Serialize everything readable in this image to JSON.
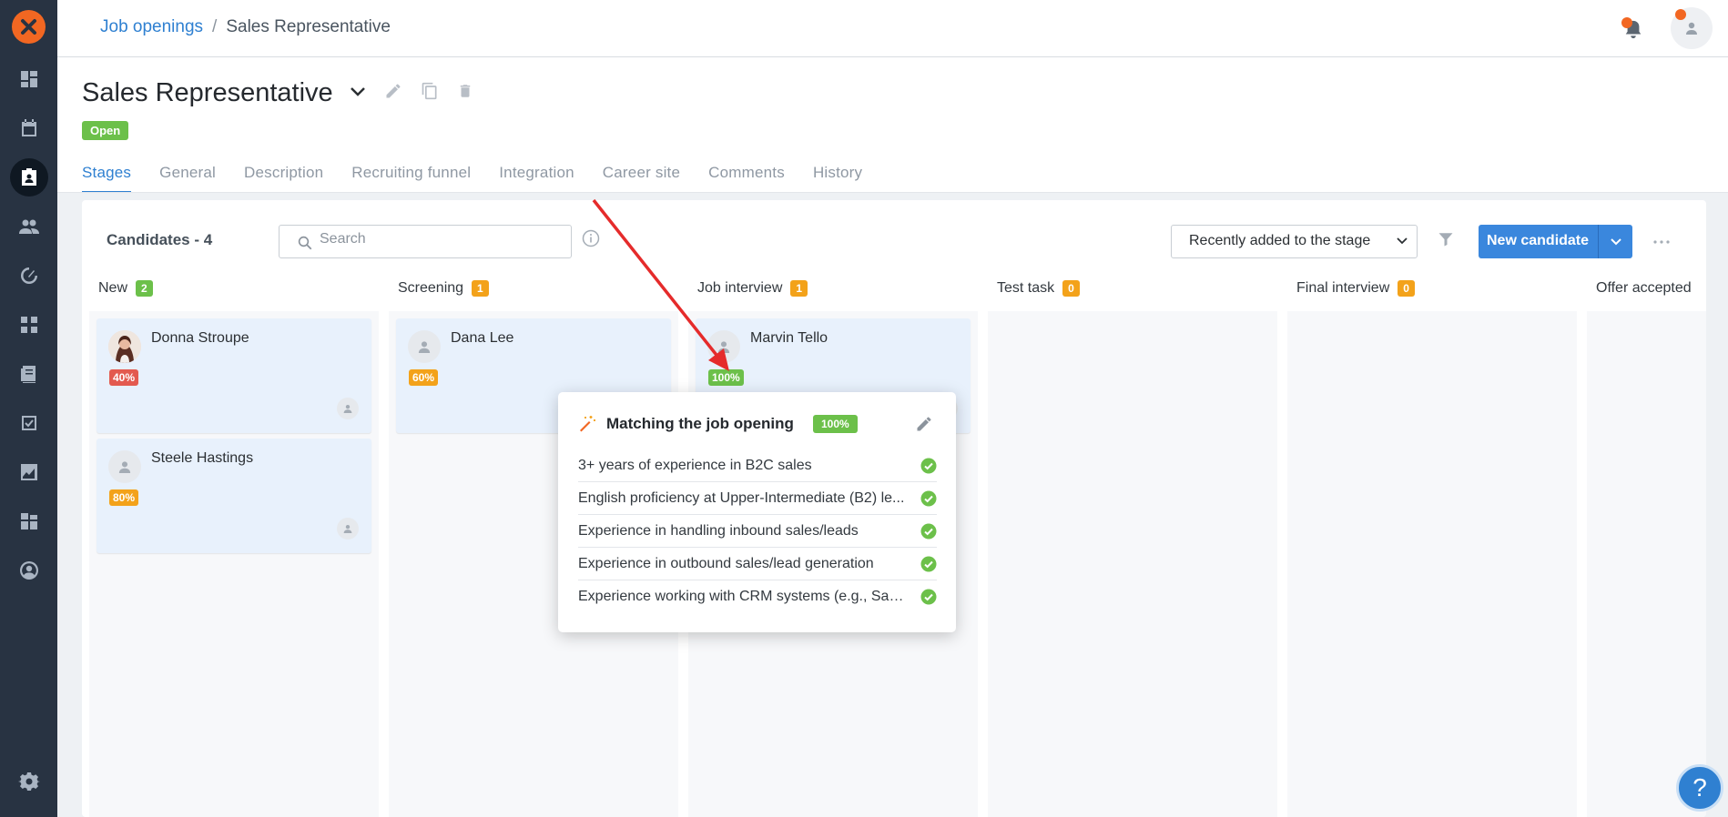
{
  "breadcrumb": {
    "parent": "Job openings",
    "separator": "/",
    "current": "Sales Representative"
  },
  "header": {
    "title": "Sales Representative",
    "status": "Open"
  },
  "tabs": [
    {
      "label": "Stages",
      "active": true
    },
    {
      "label": "General"
    },
    {
      "label": "Description"
    },
    {
      "label": "Recruiting funnel"
    },
    {
      "label": "Integration"
    },
    {
      "label": "Career site"
    },
    {
      "label": "Comments"
    },
    {
      "label": "History"
    }
  ],
  "toolbar": {
    "candidates_label": "Candidates - 4",
    "search_placeholder": "Search",
    "sort_value": "Recently added to the stage",
    "new_candidate_label": "New candidate"
  },
  "columns": [
    {
      "name": "New",
      "count": "2",
      "badge_color": "#6cc04a"
    },
    {
      "name": "Screening",
      "count": "1",
      "badge_color": "#f3a21a"
    },
    {
      "name": "Job interview",
      "count": "1",
      "badge_color": "#f3a21a"
    },
    {
      "name": "Test task",
      "count": "0",
      "badge_color": "#f3a21a"
    },
    {
      "name": "Final interview",
      "count": "0",
      "badge_color": "#f3a21a"
    },
    {
      "name": "Offer accepted",
      "count": "",
      "badge_color": "#f3a21a"
    }
  ],
  "candidates": [
    {
      "name": "Donna Stroupe",
      "match": "40%",
      "color": "#e35a4f",
      "column": "New"
    },
    {
      "name": "Steele Hastings",
      "match": "80%",
      "color": "#f3a21a",
      "column": "New"
    },
    {
      "name": "Dana Lee",
      "match": "60%",
      "color": "#f3a21a",
      "column": "Screening"
    },
    {
      "name": "Marvin Tello",
      "match": "100%",
      "color": "#6cc04a",
      "column": "Job interview"
    }
  ],
  "popup": {
    "title": "Matching the job opening",
    "score": "100%",
    "criteria": [
      "3+ years of experience in B2C sales",
      "English proficiency at Upper-Intermediate (B2) le...",
      "Experience in handling inbound sales/leads",
      "Experience in outbound sales/lead generation",
      "Experience working with CRM systems (e.g., Sales..."
    ]
  },
  "help": {
    "label": "?"
  },
  "colors": {
    "accent": "#2f80d1",
    "brand": "#f26722",
    "sidebar": "#283342",
    "green": "#6cc04a",
    "orange": "#f3a21a",
    "red": "#e35a4f"
  }
}
